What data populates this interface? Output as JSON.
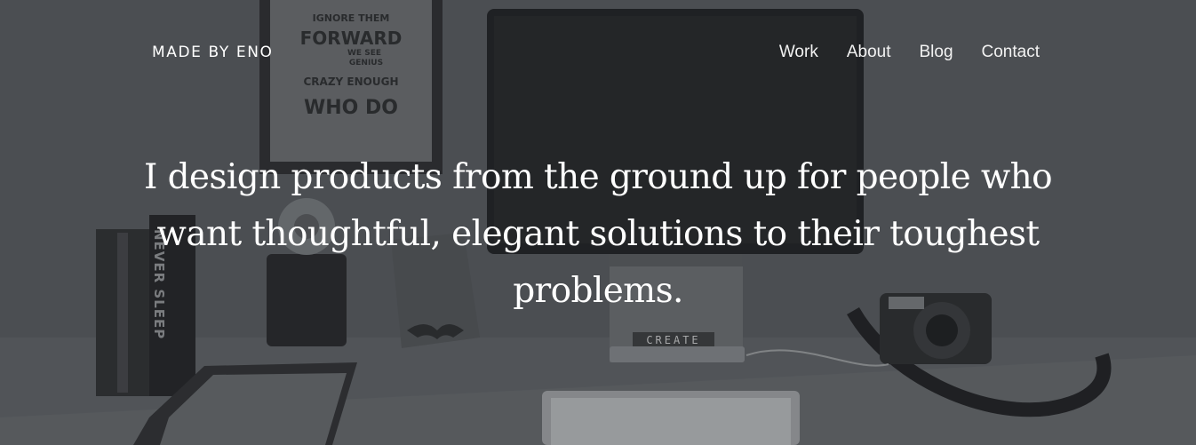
{
  "nav": {
    "brand": "MADE BY ENO",
    "links": [
      "Work",
      "About",
      "Blog",
      "Contact"
    ]
  },
  "hero": {
    "headline": "I design products from the ground up for people who want thoughtful, elegant solutions to their toughest problems."
  },
  "background": {
    "poster_lines": [
      "IGNORE THEM",
      "FORWARD",
      "WE SEE",
      "GENIUS",
      "CRAZY ENOUGH",
      "WHO DO"
    ],
    "book_spine": "NEVER SLEEP",
    "tiles": "CREATE"
  },
  "colors": {
    "text": "#ffffff",
    "overlay": "#4b4d50"
  }
}
